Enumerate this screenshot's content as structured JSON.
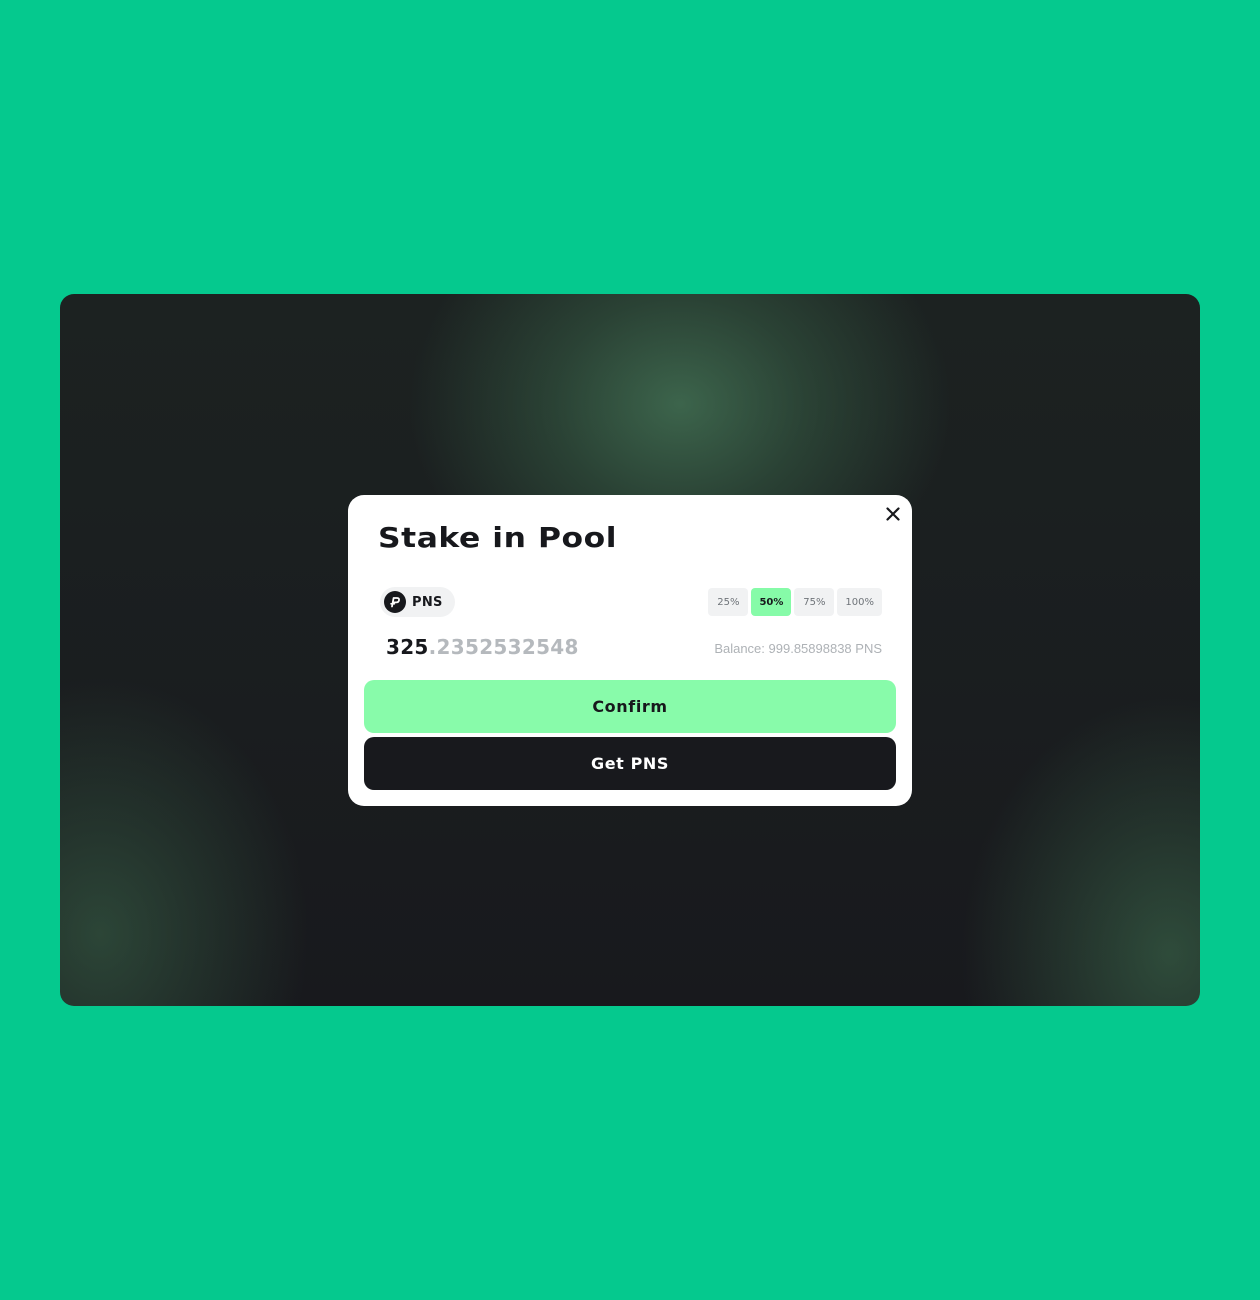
{
  "colors": {
    "page_background": "#05c98e",
    "modal_background": "#ffffff",
    "accent_green": "#88fbaa",
    "dark": "#18191d",
    "muted_text": "#aeb2b6"
  },
  "modal": {
    "title": "Stake in Pool",
    "close_icon": "close-icon",
    "token": {
      "symbol": "PNS",
      "icon": "pns-token-logo"
    },
    "percent_options": [
      "25%",
      "50%",
      "75%",
      "100%"
    ],
    "selected_percent": "50%",
    "amount": {
      "integer_part": "325",
      "decimal_part": ".2352532548"
    },
    "balance_text": "Balance: 999.85898838 PNS",
    "confirm_label": "Confirm",
    "get_token_label": "Get PNS"
  }
}
